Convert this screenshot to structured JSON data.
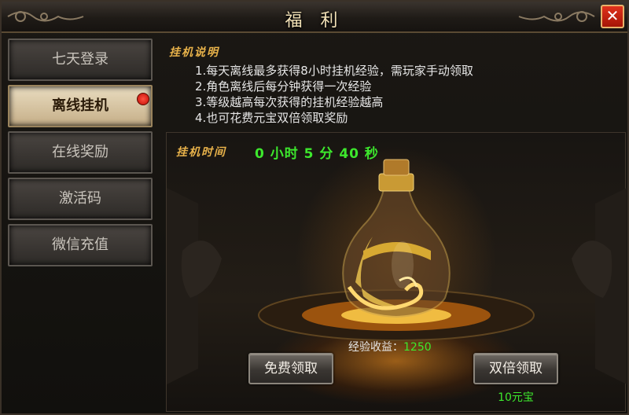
{
  "window": {
    "title": "福 利",
    "close_label": "✕"
  },
  "sidebar": {
    "items": [
      {
        "label": "七天登录",
        "active": false
      },
      {
        "label": "离线挂机",
        "active": true,
        "badge": "red-dot"
      },
      {
        "label": "在线奖励",
        "active": false
      },
      {
        "label": "激活码",
        "active": false
      },
      {
        "label": "微信充值",
        "active": false
      }
    ]
  },
  "description": {
    "title": "挂机说明",
    "lines": [
      "1.每天离线最多获得8小时挂机经验，需玩家手动领取",
      "2.角色离线后每分钟获得一次经验",
      "3.等级越高每次获得的挂机经验越高",
      "4.也可花费元宝双倍领取奖励"
    ]
  },
  "panel": {
    "time_label": "挂机时间",
    "time_value": "0 小时  5  分 40 秒",
    "exp_label": "经验收益：",
    "exp_value": "1250",
    "free_button": "免费领取",
    "double_button": "双倍领取",
    "double_price": "10元宝"
  },
  "colors": {
    "accent_gold": "#e8b24a",
    "value_green": "#3de82d",
    "close_red": "#c4200e"
  },
  "icons": [
    "close-icon",
    "red-dot-badge",
    "potion-bottle"
  ]
}
